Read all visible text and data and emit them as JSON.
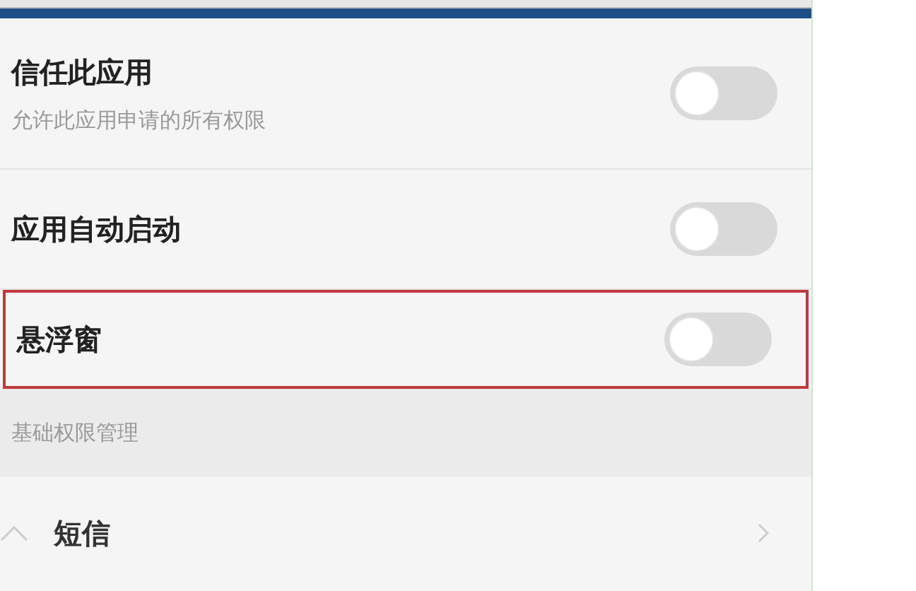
{
  "settings": [
    {
      "title": "信任此应用",
      "subtitle": "允许此应用申请的所有权限",
      "on": false,
      "highlighted": false
    },
    {
      "title": "应用自动启动",
      "on": false,
      "highlighted": false
    },
    {
      "title": "悬浮窗",
      "on": false,
      "highlighted": true
    }
  ],
  "section_header": "基础权限管理",
  "permissions": [
    {
      "title": "短信"
    }
  ]
}
